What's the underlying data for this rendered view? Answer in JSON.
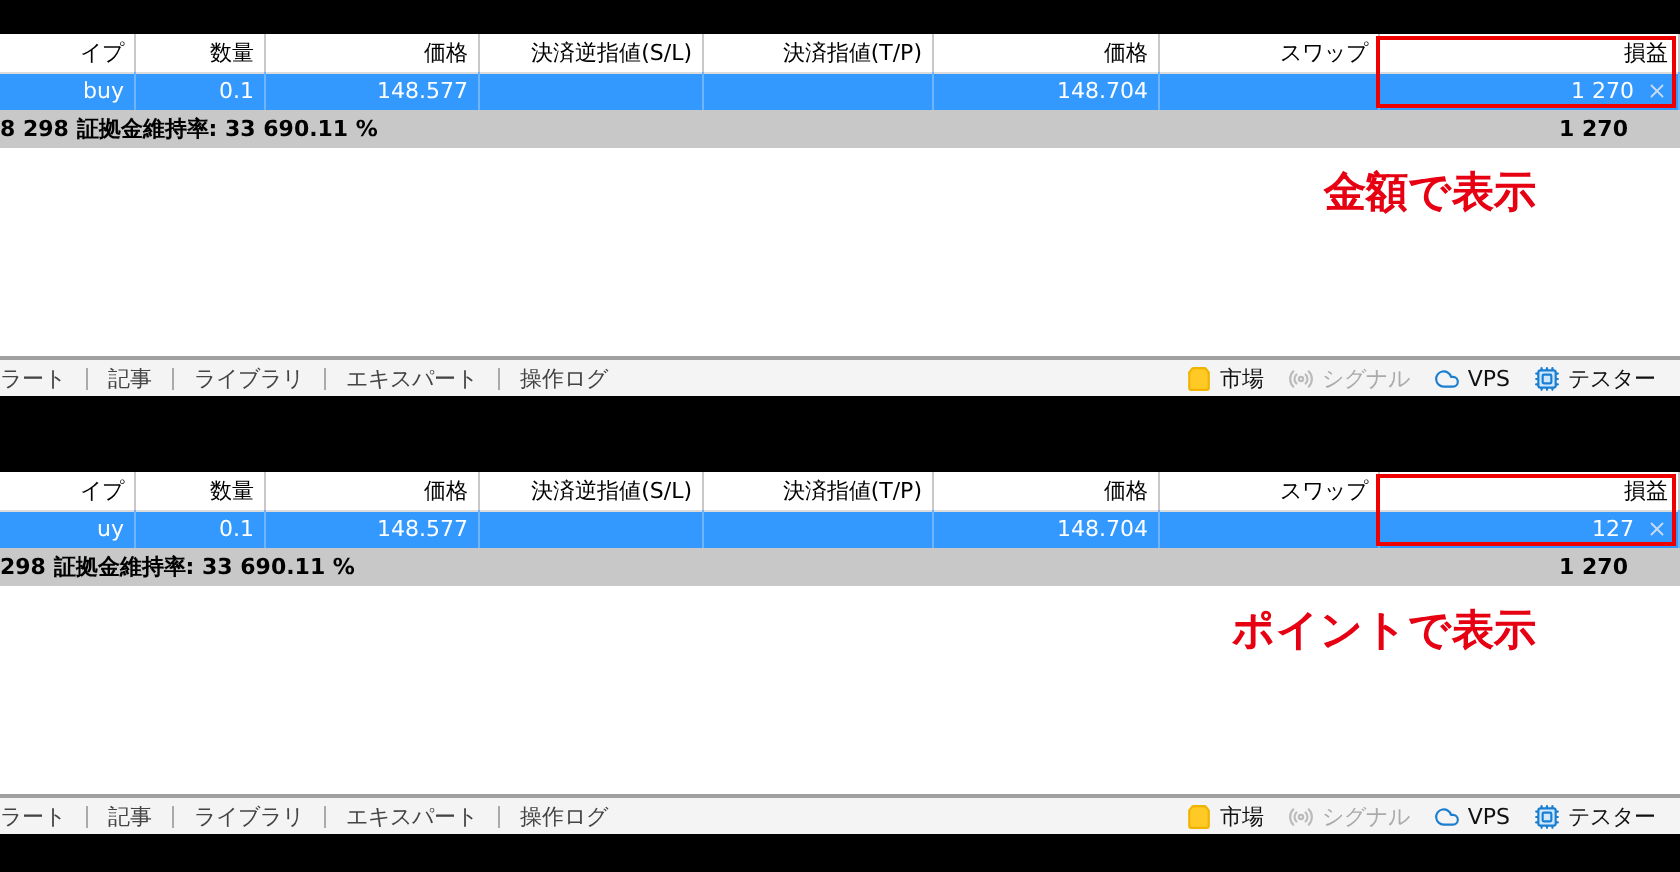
{
  "panels": [
    {
      "columns": [
        "イプ",
        "数量",
        "価格",
        "決済逆指値(S/L)",
        "決済指値(T/P)",
        "価格",
        "スワップ",
        "損益"
      ],
      "rows": [
        {
          "selected": true,
          "cells": [
            "buy",
            "0.1",
            "148.577",
            "",
            "",
            "148.704",
            "",
            "1 270"
          ]
        }
      ],
      "summary": {
        "text": "8 298  証拠金維持率: 33 690.11 %",
        "total": "1 270"
      },
      "last_column_framed": true,
      "annotation": "金額で表示",
      "tabs": [
        "ラート",
        "記事",
        "ライブラリ",
        "エキスパート",
        "操作ログ"
      ],
      "status_items": [
        {
          "kind": "market",
          "label": "市場",
          "disabled": false
        },
        {
          "kind": "signal",
          "label": "シグナル",
          "disabled": true
        },
        {
          "kind": "vps",
          "label": "VPS",
          "disabled": false
        },
        {
          "kind": "tester",
          "label": "テスター",
          "disabled": false
        }
      ]
    },
    {
      "columns": [
        "イプ",
        "数量",
        "価格",
        "決済逆指値(S/L)",
        "決済指値(T/P)",
        "価格",
        "スワップ",
        "損益"
      ],
      "rows": [
        {
          "selected": true,
          "cells": [
            "uy",
            "0.1",
            "148.577",
            "",
            "",
            "148.704",
            "",
            "127"
          ]
        }
      ],
      "summary": {
        "text": "298  証拠金維持率: 33 690.11 %",
        "total": "1 270"
      },
      "last_column_framed": true,
      "annotation": "ポイントで表示",
      "tabs": [
        "ラート",
        "記事",
        "ライブラリ",
        "エキスパート",
        "操作ログ"
      ],
      "status_items": [
        {
          "kind": "market",
          "label": "市場",
          "disabled": false
        },
        {
          "kind": "signal",
          "label": "シグナル",
          "disabled": true
        },
        {
          "kind": "vps",
          "label": "VPS",
          "disabled": false
        },
        {
          "kind": "tester",
          "label": "テスター",
          "disabled": false
        }
      ]
    }
  ]
}
